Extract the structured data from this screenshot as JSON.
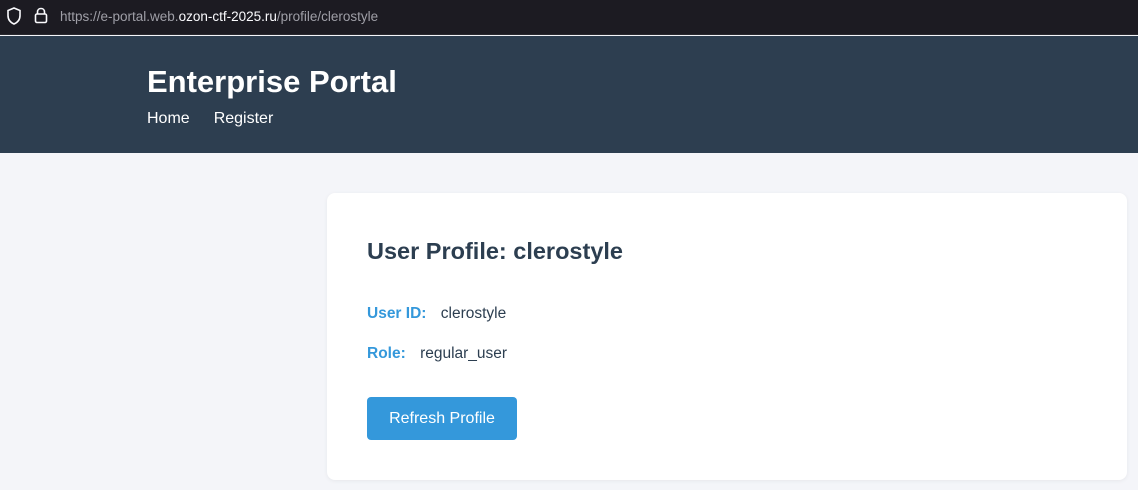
{
  "browser": {
    "url_prefix": "https://e-portal.web.",
    "url_domain": "ozon-ctf-2025.ru",
    "url_path": "/profile/clerostyle"
  },
  "header": {
    "title": "Enterprise Portal",
    "nav": [
      {
        "label": "Home"
      },
      {
        "label": "Register"
      }
    ]
  },
  "profile": {
    "heading": "User Profile: clerostyle",
    "user_id_label": "User ID:",
    "user_id_value": "clerostyle",
    "role_label": "Role:",
    "role_value": "regular_user",
    "refresh_label": "Refresh Profile"
  },
  "colors": {
    "header_bg": "#2d3e50",
    "accent": "#3498db",
    "text_dark": "#2c3e50",
    "page_bg": "#f4f5f9"
  }
}
